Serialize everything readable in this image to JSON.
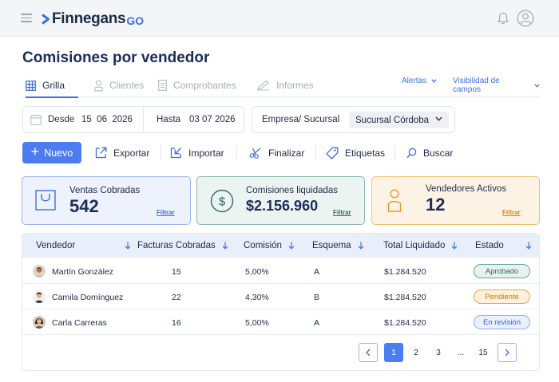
{
  "header": {
    "logo_main": "Finnegans",
    "logo_suffix": "GO",
    "icons": [
      "hamburger-menu-icon",
      "bell-icon",
      "user-avatar-icon"
    ]
  },
  "page": {
    "title": "Comisiones por vendedor"
  },
  "tabs": [
    {
      "label": "Grilla",
      "icon": "grid-icon",
      "active": true
    },
    {
      "label": "Clientes",
      "icon": "person-icon",
      "active": false
    },
    {
      "label": "Comprobantes",
      "icon": "document-icon",
      "active": false
    },
    {
      "label": "Informes",
      "icon": "pencil-icon",
      "active": false
    }
  ],
  "tab_actions": {
    "alerts": "Alertas",
    "fields": "Visibilidad de campos"
  },
  "filters": {
    "from_label": "Desde",
    "from_value": "15  06  2026",
    "to_label": "Hasta",
    "to_value": "03 07 2026",
    "branch_label": "Empresa/ Sucursal",
    "branch_value": "Sucursal Córdoba"
  },
  "toolbar": {
    "new": "Nuevo",
    "export": "Exportar",
    "import": "Importar",
    "finish": "Finalizar",
    "tags": "Etiquetas",
    "search": "Buscar"
  },
  "cards": [
    {
      "title": "Ventas Cobradas",
      "value": "542",
      "link": "Filtrar",
      "icon": "shopping-bag-icon",
      "accent": "#3d6fe0"
    },
    {
      "title": "Comisiones liquidadas",
      "value": "$2.156.960",
      "link": "Filtrar",
      "icon": "dollar-circle-icon",
      "accent": "#2f6b5c"
    },
    {
      "title": "Vendedores Activos",
      "value": "12",
      "link": "Filtrar",
      "icon": "person-icon",
      "accent": "#e79a2b"
    }
  ],
  "table": {
    "columns": [
      "Vendedor",
      "Facturas Cobradas",
      "Comisión",
      "Esquema",
      "Total Liquidado",
      "Estado"
    ],
    "rows": [
      {
        "name": "Martín González",
        "invoices": "15",
        "commission": "5,00%",
        "scheme": "A",
        "total": "$1.284.520",
        "status": "Aprobado"
      },
      {
        "name": "Camila Domínguez",
        "invoices": "22",
        "commission": "4,30%",
        "scheme": "B",
        "total": "$1.284.520",
        "status": "Pendiente"
      },
      {
        "name": "Carla Carreras",
        "invoices": "16",
        "commission": "5,00%",
        "scheme": "A",
        "total": "$1.284.520",
        "status": "En revisión"
      }
    ]
  },
  "pagination": {
    "pages": [
      "1",
      "2",
      "3",
      "...",
      "15"
    ],
    "current": "1"
  },
  "colors": {
    "primary": "#4b7cf0",
    "title": "#1c2c5b",
    "success": "#2f6b5c",
    "warning": "#e79a2b"
  }
}
